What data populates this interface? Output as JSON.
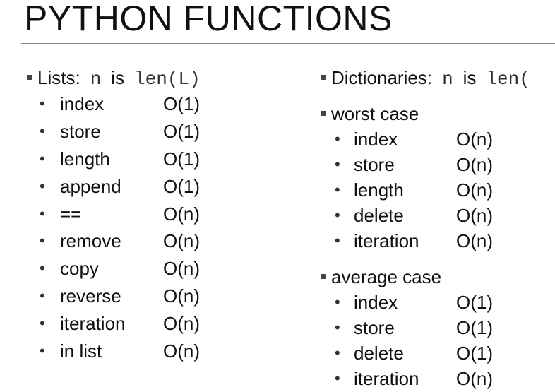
{
  "title": "PYTHON FUNCTIONS",
  "lists": {
    "heading_label": "Lists:",
    "heading_var": "n",
    "heading_is": "is",
    "heading_expr": "len(L)",
    "items": [
      {
        "name": "index",
        "complexity": "O(1)"
      },
      {
        "name": "store",
        "complexity": "O(1)"
      },
      {
        "name": "length",
        "complexity": "O(1)"
      },
      {
        "name": "append",
        "complexity": "O(1)"
      },
      {
        "name": "==",
        "complexity": "O(n)"
      },
      {
        "name": "remove",
        "complexity": "O(n)"
      },
      {
        "name": "copy",
        "complexity": "O(n)"
      },
      {
        "name": "reverse",
        "complexity": "O(n)"
      },
      {
        "name": "iteration",
        "complexity": "O(n)"
      },
      {
        "name": "in list",
        "complexity": "O(n)"
      }
    ]
  },
  "dictionaries": {
    "heading_label": "Dictionaries:",
    "heading_var": "n",
    "heading_is": "is",
    "heading_expr": "len(",
    "worst": {
      "label": "worst case",
      "items": [
        {
          "name": "index",
          "complexity": "O(n)"
        },
        {
          "name": "store",
          "complexity": "O(n)"
        },
        {
          "name": "length",
          "complexity": "O(n)"
        },
        {
          "name": "delete",
          "complexity": "O(n)"
        },
        {
          "name": "iteration",
          "complexity": "O(n)"
        }
      ]
    },
    "average": {
      "label": "average case",
      "items": [
        {
          "name": "index",
          "complexity": "O(1)"
        },
        {
          "name": "store",
          "complexity": "O(1)"
        },
        {
          "name": "delete",
          "complexity": "O(1)"
        },
        {
          "name": "iteration",
          "complexity": "O(n)"
        }
      ]
    }
  }
}
